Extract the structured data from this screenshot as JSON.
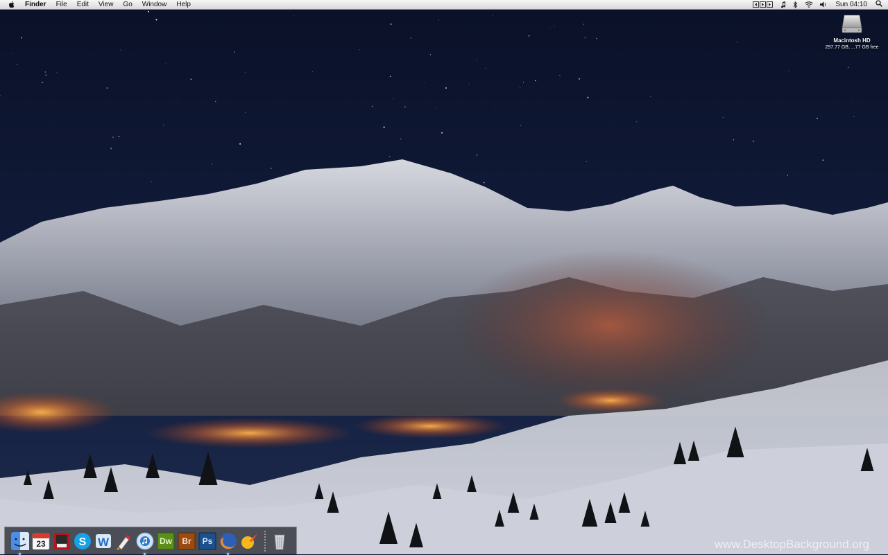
{
  "menubar": {
    "app_name": "Finder",
    "menus": [
      "File",
      "Edit",
      "View",
      "Go",
      "Window",
      "Help"
    ],
    "status_icons": [
      "display-mirroring-icon",
      "music-icon",
      "bluetooth-icon",
      "wifi-icon",
      "volume-icon"
    ],
    "clock": "Sun 04:10",
    "spotlight_icon": "spotlight-icon"
  },
  "desktop": {
    "drive": {
      "name": "Macintosh HD",
      "info": "297.77 GB, ...77 GB free"
    }
  },
  "dock": {
    "apps": [
      {
        "name": "Finder",
        "icon": "finder-icon",
        "running": true
      },
      {
        "name": "iCal",
        "icon": "calendar-icon",
        "date": "23",
        "running": false
      },
      {
        "name": "Photo Booth",
        "icon": "photo-booth-icon",
        "running": false
      },
      {
        "name": "Skype",
        "icon": "skype-icon",
        "running": false
      },
      {
        "name": "Word",
        "icon": "word-icon",
        "running": false
      },
      {
        "name": "Transmit",
        "icon": "rocket-icon",
        "running": false
      },
      {
        "name": "iTunes",
        "icon": "itunes-icon",
        "running": true
      },
      {
        "name": "Dreamweaver",
        "icon": "dreamweaver-icon",
        "label": "Dw",
        "running": false
      },
      {
        "name": "Bridge",
        "icon": "bridge-icon",
        "label": "Br",
        "running": false
      },
      {
        "name": "Photoshop",
        "icon": "photoshop-icon",
        "label": "Ps",
        "running": false
      },
      {
        "name": "Firefox",
        "icon": "firefox-icon",
        "running": true
      },
      {
        "name": "Sparkle",
        "icon": "sparkle-icon",
        "running": false
      }
    ],
    "trash": {
      "name": "Trash",
      "icon": "trash-icon"
    }
  },
  "watermark": "www.DesktopBackground.org",
  "colors": {
    "sky": "#0b1430",
    "snow": "#d8dce6",
    "lights": "#ff9a2e",
    "dock_indicator": "#9fd3ff"
  }
}
